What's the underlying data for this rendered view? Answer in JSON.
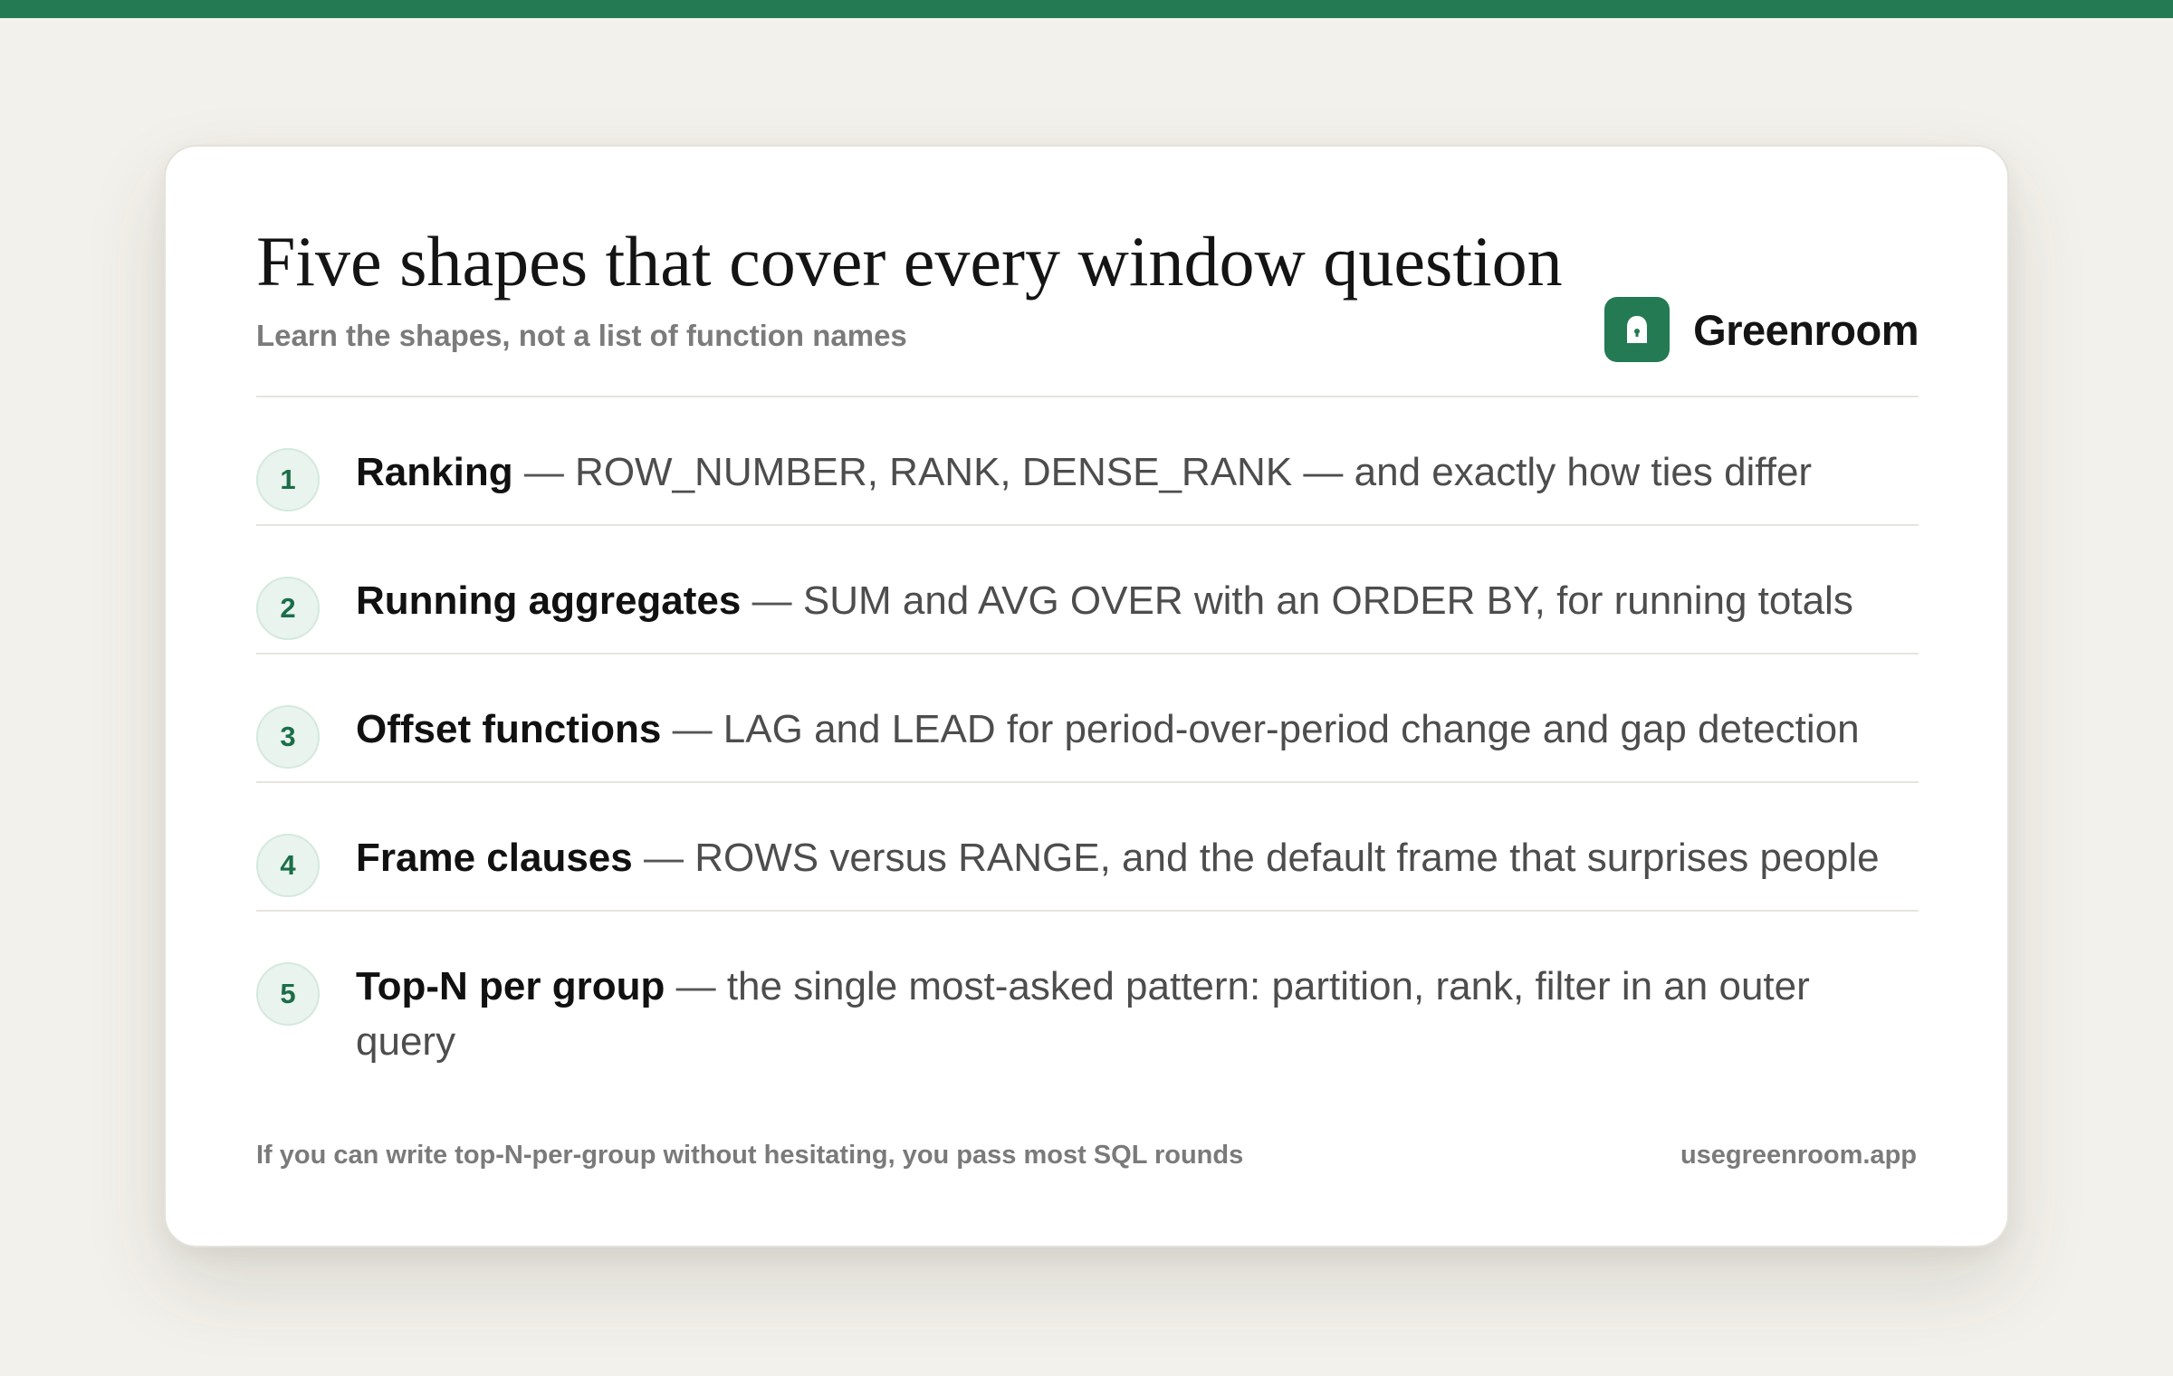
{
  "header": {
    "title": "Five shapes that cover every window question",
    "subtitle": "Learn the shapes, not a list of function names"
  },
  "brand": {
    "name": "Greenroom",
    "icon": "lock-icon",
    "color": "#237a53"
  },
  "items": [
    {
      "number": "1",
      "title": "Ranking",
      "separator": "—",
      "description": "ROW_NUMBER, RANK, DENSE_RANK — and exactly how ties differ"
    },
    {
      "number": "2",
      "title": "Running aggregates",
      "separator": "—",
      "description": "SUM and AVG OVER with an ORDER BY, for running totals"
    },
    {
      "number": "3",
      "title": "Offset functions",
      "separator": "—",
      "description": "LAG and LEAD for period-over-period change and gap detection"
    },
    {
      "number": "4",
      "title": "Frame clauses",
      "separator": "—",
      "description": "ROWS versus RANGE, and the default frame that surprises people"
    },
    {
      "number": "5",
      "title": "Top-N per group",
      "separator": "—",
      "description": "the single most-asked pattern: partition, rank, filter in an outer query"
    }
  ],
  "footer": {
    "note": "If you can write top-N-per-group without hesitating, you pass most SQL rounds",
    "url": "usegreenroom.app"
  },
  "colors": {
    "accent": "#237a53",
    "background": "#f3f1eb",
    "card": "#ffffff",
    "badge_background": "#e9f4ee"
  }
}
